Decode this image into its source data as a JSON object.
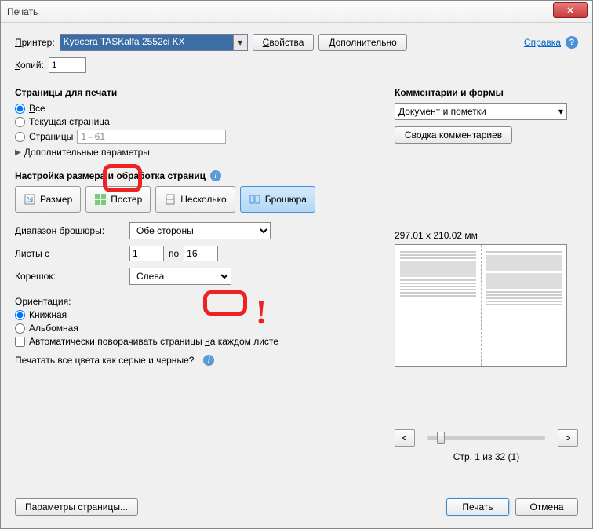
{
  "window": {
    "title": "Печать"
  },
  "header": {
    "printer_label": "Принтер:",
    "printer_value": "Kyocera TASKalfa 2552ci KX",
    "properties_btn": "Свойства",
    "advanced_btn": "Дополнительно",
    "help_link": "Справка",
    "copies_label": "Копий:",
    "copies_value": "1"
  },
  "pages": {
    "section": "Страницы для печати",
    "all": "Все",
    "current": "Текущая страница",
    "range_label": "Страницы",
    "range_value": "1 - 61",
    "more": "Дополнительные параметры"
  },
  "sizing": {
    "section": "Настройка размера и обработка страниц",
    "size_btn": "Размер",
    "poster_btn": "Постер",
    "multiple_btn": "Несколько",
    "booklet_btn": "Брошюра"
  },
  "booklet": {
    "subset_label": "Диапазон брошюры:",
    "subset_value": "Обе стороны",
    "sheets_from_label": "Листы с",
    "sheets_from_value": "1",
    "to_label": "по",
    "sheets_to_value": "16",
    "binding_label": "Корешок:",
    "binding_value": "Слева"
  },
  "orientation": {
    "section": "Ориентация:",
    "portrait": "Книжная",
    "landscape": "Альбомная",
    "autorotate": "Автоматически поворачивать страницы на каждом листе"
  },
  "grayscale_prompt": "Печатать все цвета как серые и черные?",
  "comments": {
    "section": "Комментарии и формы",
    "select_value": "Документ и пометки",
    "summarize_btn": "Сводка комментариев"
  },
  "preview": {
    "dims": "297.01 x 210.02 мм",
    "page_status": "Стр. 1 из 32 (1)"
  },
  "footer": {
    "page_setup": "Параметры страницы...",
    "print": "Печать",
    "cancel": "Отмена"
  }
}
